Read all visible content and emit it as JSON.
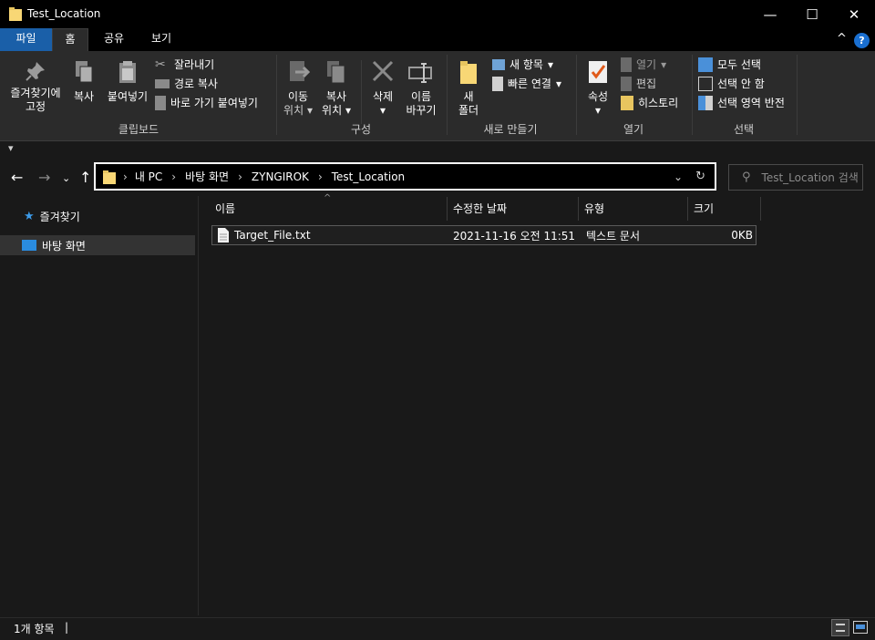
{
  "window": {
    "title": "Test_Location",
    "minimize": "—",
    "maximize": "☐",
    "close": "✕"
  },
  "tabs": {
    "file": "파일",
    "home": "홈",
    "share": "공유",
    "view": "보기",
    "collapse": "^",
    "help": "?"
  },
  "ribbon": {
    "clipboard": {
      "pin": [
        "즐겨찾기에",
        "고정"
      ],
      "copy": "복사",
      "paste": "붙여넣기",
      "cut": "잘라내기",
      "copy_path": "경로 복사",
      "paste_shortcut": "바로 가기 붙여넣기",
      "label": "클립보드"
    },
    "organize": {
      "move_to": [
        "이동",
        "위치"
      ],
      "copy_to": [
        "복사",
        "위치"
      ],
      "delete": "삭제",
      "rename": [
        "이름",
        "바꾸기"
      ],
      "label": "구성"
    },
    "new": {
      "new_folder": [
        "새",
        "폴더"
      ],
      "new_item": "새 항목",
      "easy_access": "빠른 연결",
      "label": "새로 만들기"
    },
    "open": {
      "properties": "속성",
      "open": "열기",
      "edit": "편집",
      "history": "히스토리",
      "label": "열기"
    },
    "select": {
      "select_all": "모두 선택",
      "select_none": "선택 안 함",
      "invert": "선택 영역 반전",
      "label": "선택"
    }
  },
  "address": {
    "crumbs": [
      "내 PC",
      "바탕 화면",
      "ZYNGIROK",
      "Test_Location"
    ],
    "search_placeholder": "Test_Location 검색"
  },
  "nav": {
    "quick_access": "즐겨찾기",
    "desktop": "바탕 화면"
  },
  "columns": {
    "name": "이름",
    "date": "수정한 날짜",
    "type": "유형",
    "size": "크기"
  },
  "files": [
    {
      "name": "Target_File.txt",
      "date": "2021-11-16 오전 11:51",
      "type": "텍스트 문서",
      "size": "0KB"
    }
  ],
  "status": {
    "count": "1개 항목",
    "separator": "|"
  },
  "colors": {
    "accent": "#1a5fa8",
    "background": "#191919",
    "ribbon": "#2b2b2b",
    "folder": "#f8d775"
  }
}
